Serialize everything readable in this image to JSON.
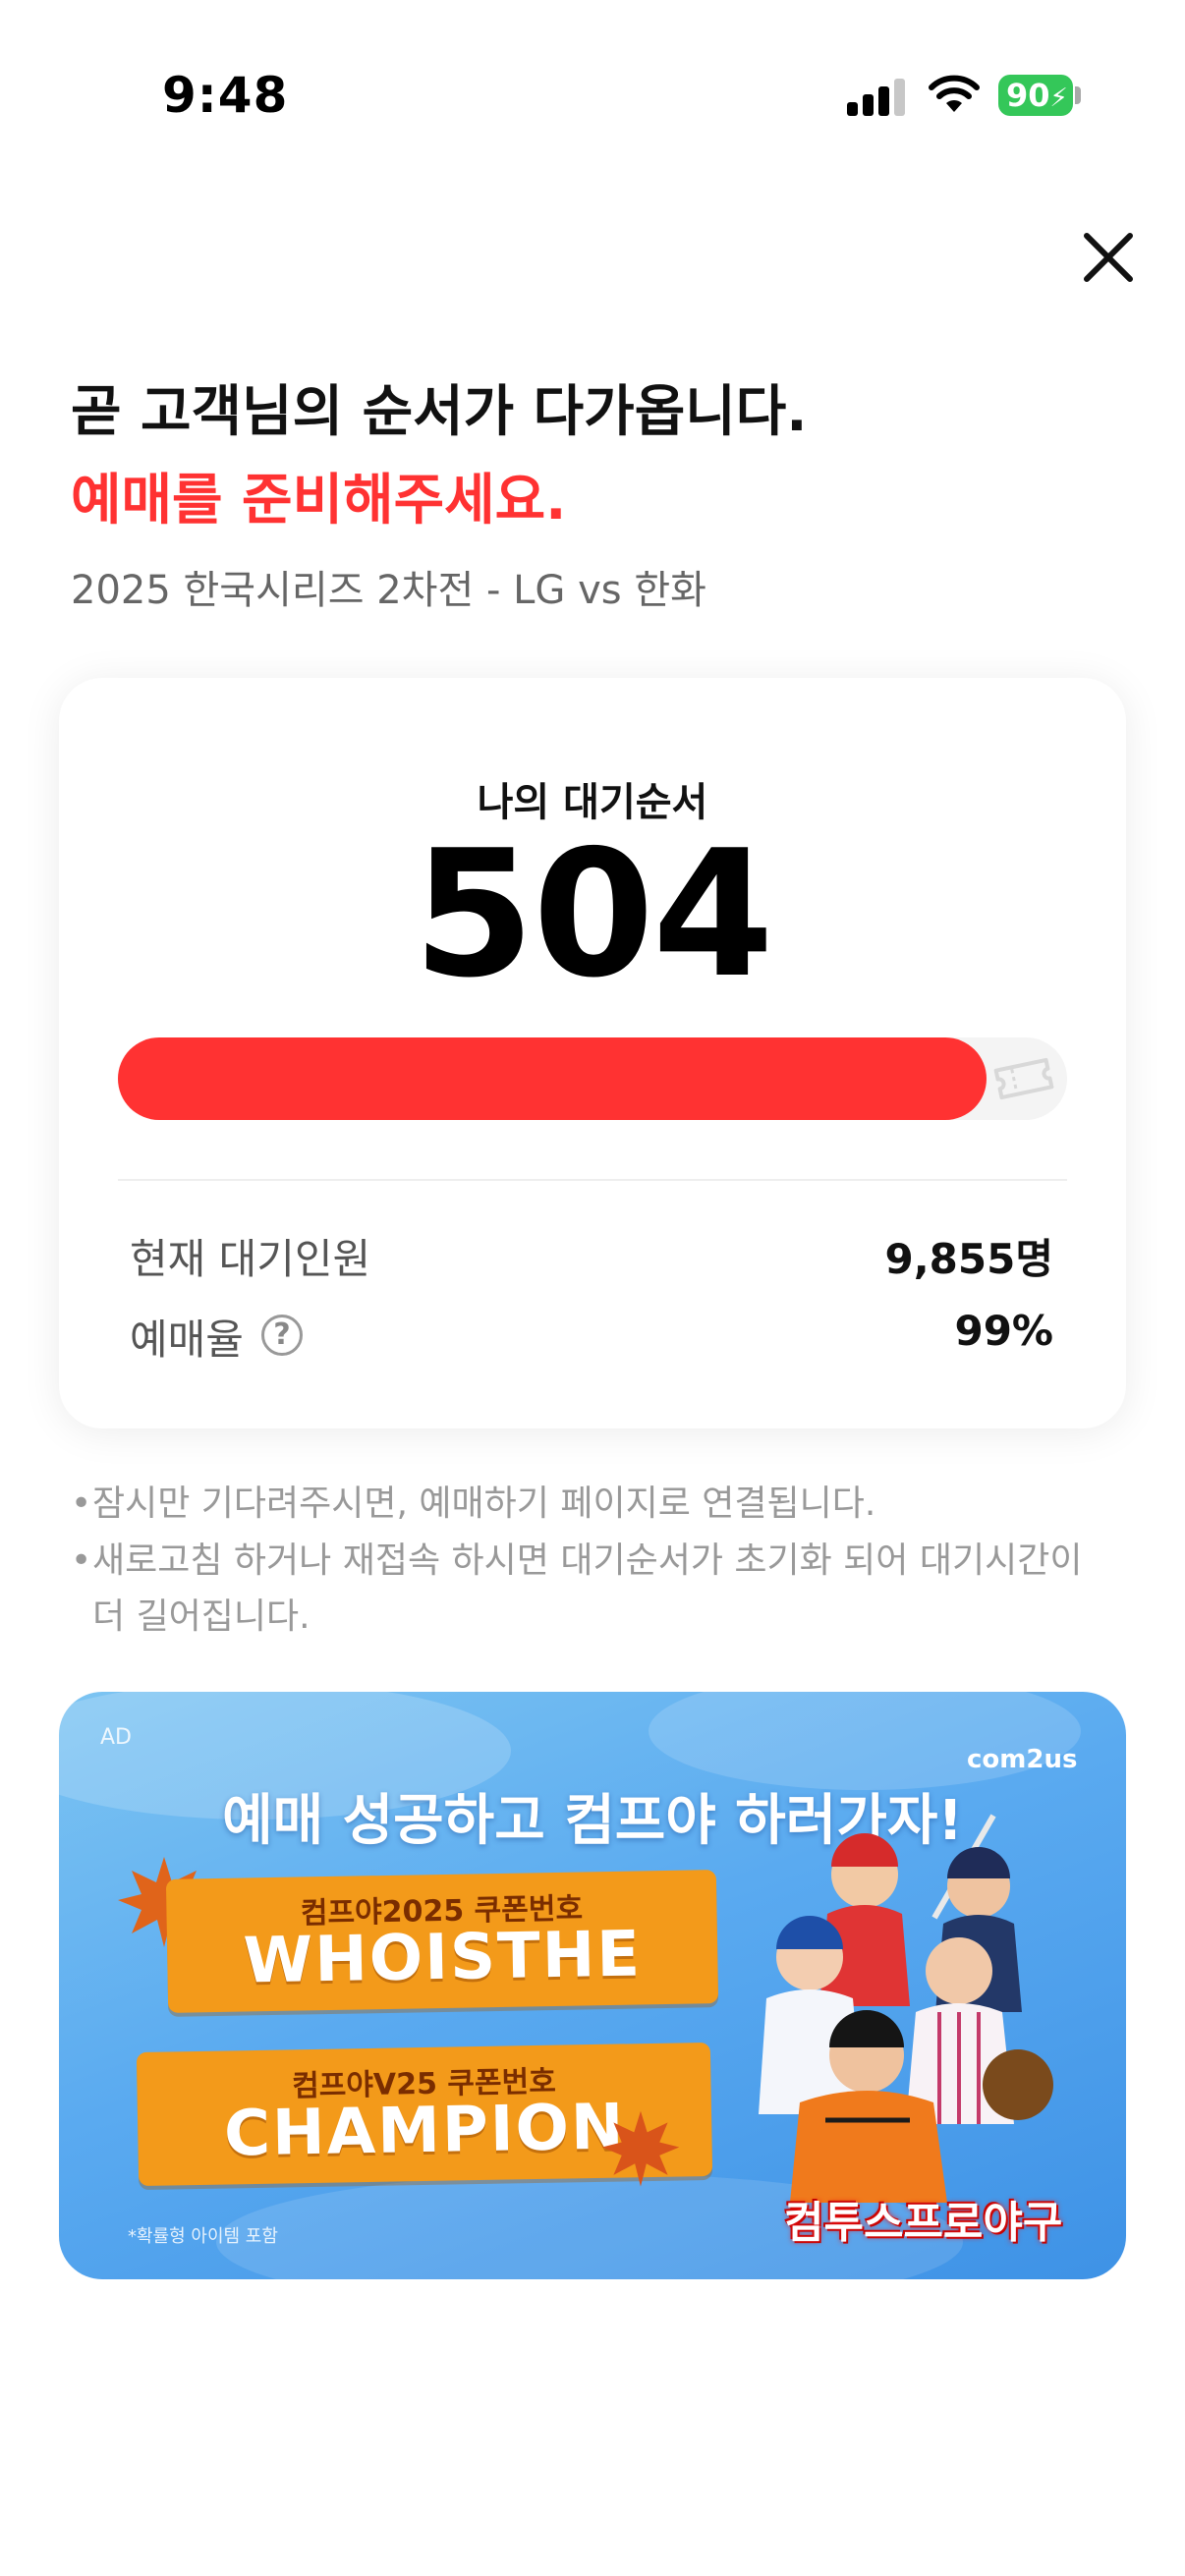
{
  "status_bar": {
    "time": "9:48",
    "battery": "90"
  },
  "header": {
    "title_line1": "곧 고객님의 순서가 다가옵니다.",
    "title_line2": "예매를 준비해주세요.",
    "subtitle": "2025 한국시리즈 2차전 - LG vs 한화"
  },
  "queue": {
    "label": "나의 대기순서",
    "number": "504",
    "progress": 0.915,
    "progress_icon": "ticket-icon",
    "current_waiting_label": "현재 대기인원",
    "current_waiting_value": "9,855명",
    "booking_rate_label": "예매율",
    "booking_rate_help": "?",
    "booking_rate_value": "99%"
  },
  "notes": [
    "잠시만 기다려주시면, 예매하기 페이지로 연결됩니다.",
    "새로고침 하거나 재접속 하시면 대기순서가 초기화 되어 대기시간이 더 길어집니다."
  ],
  "ad": {
    "tag": "AD",
    "brand": "com2us",
    "headline": "예매 성공하고 컴프야 하러가자!",
    "coupon1_caption": "컴프야2025 쿠폰번호",
    "coupon1_code": "WHOISTHE",
    "coupon2_caption": "컴프야V25 쿠폰번호",
    "coupon2_code": "CHAMPION",
    "footnote": "*확률형 아이템 포함",
    "game_logo": "컴투스프로야구"
  },
  "colors": {
    "accent": "#ff3232",
    "battery": "#34c759",
    "ad_bg": "#5aaaf0",
    "coupon": "#f39a1a"
  }
}
